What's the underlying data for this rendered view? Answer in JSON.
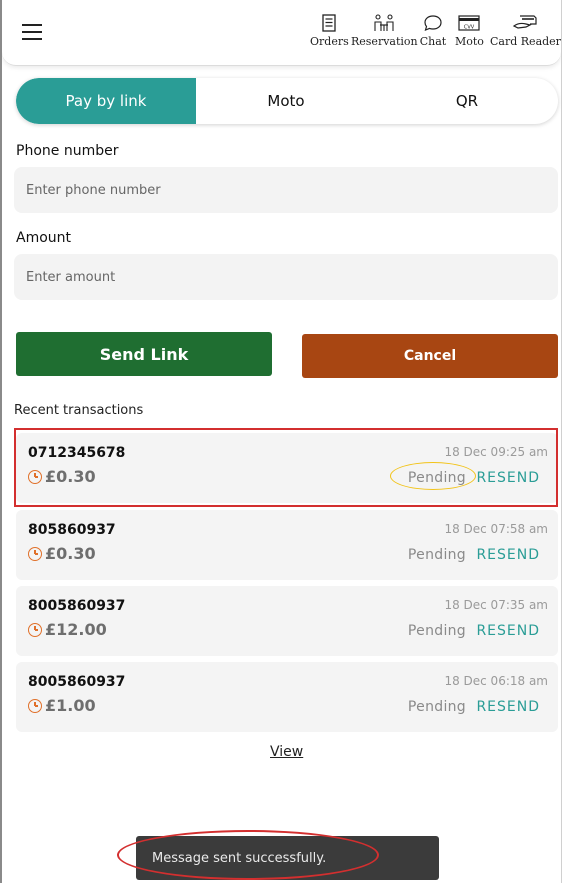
{
  "header": {
    "nav": [
      {
        "label": "Orders",
        "icon": "orders-icon"
      },
      {
        "label": "Reservation",
        "icon": "reservation-icon"
      },
      {
        "label": "Chat",
        "icon": "chat-icon"
      },
      {
        "label": "Moto",
        "icon": "moto-icon",
        "icon_text": "CVV"
      },
      {
        "label": "Card Reader",
        "icon": "card-reader-icon"
      }
    ]
  },
  "tabs": [
    {
      "label": "Pay by link",
      "active": true
    },
    {
      "label": "Moto",
      "active": false
    },
    {
      "label": "QR",
      "active": false
    }
  ],
  "form": {
    "phone_label": "Phone number",
    "phone_placeholder": "Enter phone number",
    "amount_label": "Amount",
    "amount_placeholder": "Enter amount",
    "send_label": "Send Link",
    "cancel_label": "Cancel"
  },
  "colors": {
    "accent": "#2a9d96",
    "send": "#1f6e31",
    "cancel": "#a84612",
    "annotation_red": "#d32f2f",
    "annotation_yellow": "#f2c318"
  },
  "transactions": {
    "title": "Recent transactions",
    "items": [
      {
        "phone": "0712345678",
        "date": "18 Dec 09:25 am",
        "amount": "£0.30",
        "status": "Pending",
        "action": "RESEND"
      },
      {
        "phone": "805860937",
        "date": "18 Dec 07:58 am",
        "amount": "£0.30",
        "status": "Pending",
        "action": "RESEND"
      },
      {
        "phone": "8005860937",
        "date": "18 Dec 07:35 am",
        "amount": "£12.00",
        "status": "Pending",
        "action": "RESEND"
      },
      {
        "phone": "8005860937",
        "date": "18 Dec 06:18 am",
        "amount": "£1.00",
        "status": "Pending",
        "action": "RESEND"
      }
    ],
    "view_label": "View"
  },
  "toast": {
    "message": "Message sent successfully."
  }
}
